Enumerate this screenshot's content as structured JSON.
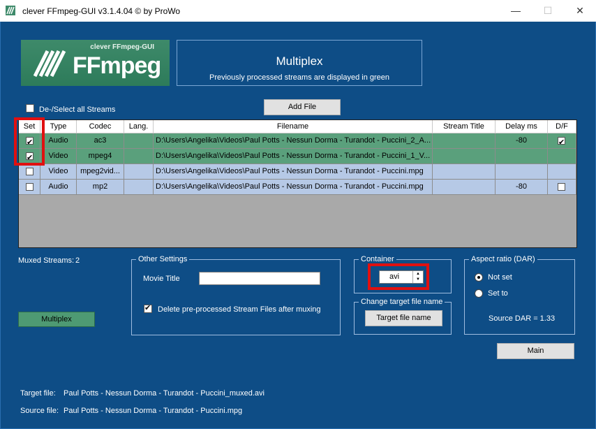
{
  "window": {
    "title": "clever FFmpeg-GUI v3.1.4.04   © by ProWo"
  },
  "logo": {
    "subtitle": "clever FFmpeg-GUI",
    "name": "FFmpeg"
  },
  "header": {
    "title": "Multiplex",
    "subtitle": "Previously processed streams are displayed in green"
  },
  "select_all_label": "De-/Select all Streams",
  "add_file_label": "Add File",
  "columns": [
    "Set",
    "Type",
    "Codec",
    "Lang.",
    "Filename",
    "Stream Title",
    "Delay ms",
    "D/F"
  ],
  "rows": [
    {
      "checked": true,
      "type": "Audio",
      "codec": "ac3",
      "lang": "",
      "filename": "D:\\Users\\Angelika\\Videos\\Paul Potts - Nessun Dorma - Turandot - Puccini_2_A...",
      "title": "",
      "delay": "-80",
      "df": "checked",
      "color": "green"
    },
    {
      "checked": true,
      "type": "Video",
      "codec": "mpeg4",
      "lang": "",
      "filename": "D:\\Users\\Angelika\\Videos\\Paul Potts - Nessun Dorma - Turandot - Puccini_1_V...",
      "title": "",
      "delay": "",
      "df": "none",
      "color": "green"
    },
    {
      "checked": false,
      "type": "Video",
      "codec": "mpeg2vid...",
      "lang": "",
      "filename": "D:\\Users\\Angelika\\Videos\\Paul Potts - Nessun Dorma - Turandot - Puccini.mpg",
      "title": "",
      "delay": "",
      "df": "none",
      "color": "blue"
    },
    {
      "checked": false,
      "type": "Audio",
      "codec": "mp2",
      "lang": "",
      "filename": "D:\\Users\\Angelika\\Videos\\Paul Potts - Nessun Dorma - Turandot - Puccini.mpg",
      "title": "",
      "delay": "-80",
      "df": "unchecked",
      "color": "blue"
    }
  ],
  "muxed": {
    "label": "Muxed Streams:",
    "count": "2"
  },
  "multiplex_button": "Multiplex",
  "other_settings": {
    "legend": "Other Settings",
    "movie_title_label": "Movie Title",
    "movie_title_value": "",
    "delete_label": "Delete pre-processed Stream Files after muxing"
  },
  "container": {
    "legend": "Container",
    "value": "avi"
  },
  "change_target": {
    "legend": "Change target file name",
    "button": "Target file name"
  },
  "aspect": {
    "legend": "Aspect ratio (DAR)",
    "option1": "Not set",
    "option2": "Set to",
    "source_dar": "Source DAR = 1.33"
  },
  "main_button": "Main",
  "target_file": {
    "label": "Target file:",
    "value": "Paul Potts - Nessun Dorma - Turandot - Puccini_muxed.avi"
  },
  "source_file": {
    "label": "Source file:",
    "value": "Paul Potts - Nessun Dorma - Turandot - Puccini.mpg"
  },
  "colors": {
    "background": "#0e4d86",
    "green_row": "#5aa07c",
    "blue_row": "#b6c9e6",
    "highlight": "#e01010"
  }
}
